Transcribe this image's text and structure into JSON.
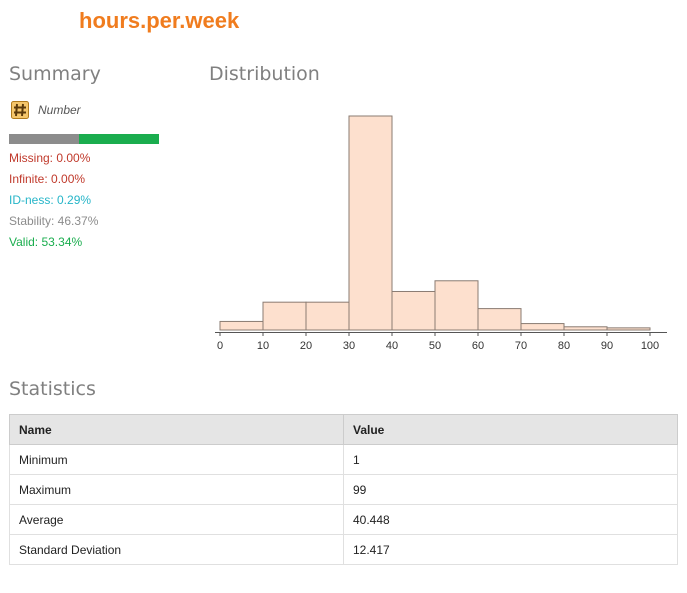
{
  "column_title": "hours.per.week",
  "summary": {
    "title": "Summary",
    "type_label": "Number",
    "type_icon": "hash-icon",
    "quality_bar": {
      "invalid_fraction": 0.4666,
      "valid_fraction": 0.5334,
      "invalid_color": "#8c8c8c",
      "valid_color": "#1aad4e"
    },
    "stats": [
      {
        "label": "Missing: 0.00%",
        "color": "#c0392b"
      },
      {
        "label": "Infinite: 0.00%",
        "color": "#c0392b"
      },
      {
        "label": "ID-ness: 0.29%",
        "color": "#26b5c8"
      },
      {
        "label": "Stability: 46.37%",
        "color": "#8c8c8c"
      },
      {
        "label": "Valid: 53.34%",
        "color": "#1aad4e"
      }
    ]
  },
  "distribution": {
    "title": "Distribution"
  },
  "chart_data": {
    "type": "bar",
    "bins": [
      [
        0,
        10
      ],
      [
        10,
        20
      ],
      [
        20,
        30
      ],
      [
        30,
        40
      ],
      [
        40,
        50
      ],
      [
        50,
        60
      ],
      [
        60,
        70
      ],
      [
        70,
        80
      ],
      [
        80,
        90
      ],
      [
        90,
        100
      ]
    ],
    "values": [
      4,
      13,
      13,
      100,
      18,
      23,
      10,
      3,
      1.5,
      1
    ],
    "ticks": [
      "0",
      "10",
      "20",
      "30",
      "40",
      "50",
      "60",
      "70",
      "80",
      "90",
      "100"
    ],
    "xlim": [
      0,
      100
    ],
    "ylim": [
      0,
      100
    ],
    "bar_fill": "#fde0ce",
    "bar_stroke": "#8a7b72",
    "grid": false,
    "title": "",
    "xlabel": "",
    "ylabel": ""
  },
  "statistics": {
    "title": "Statistics",
    "headers": {
      "name": "Name",
      "value": "Value"
    },
    "rows": [
      {
        "name": "Minimum",
        "value": "1"
      },
      {
        "name": "Maximum",
        "value": "99"
      },
      {
        "name": "Average",
        "value": "40.448"
      },
      {
        "name": "Standard Deviation",
        "value": "12.417"
      }
    ]
  }
}
